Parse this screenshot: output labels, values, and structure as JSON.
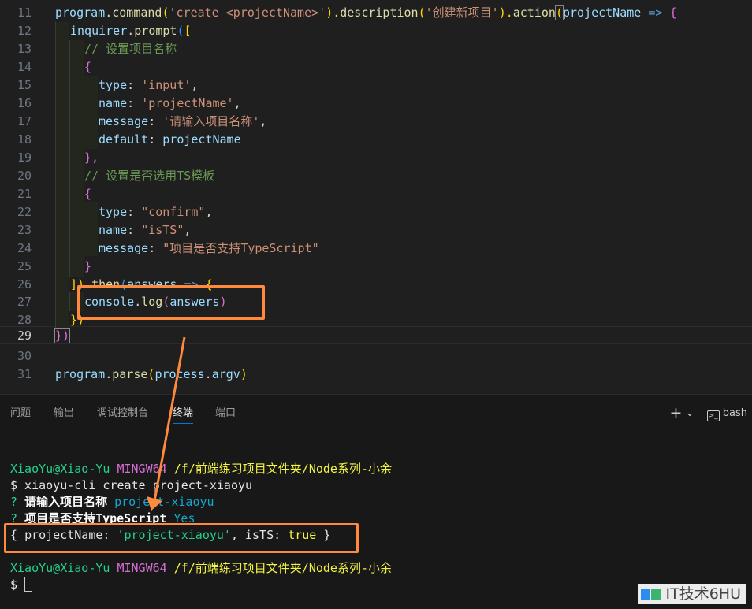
{
  "editor": {
    "lines": [
      {
        "n": "11",
        "html_key": "l11"
      },
      {
        "n": "12"
      },
      {
        "n": "13"
      },
      {
        "n": "14"
      },
      {
        "n": "15"
      },
      {
        "n": "16"
      },
      {
        "n": "17"
      },
      {
        "n": "18"
      },
      {
        "n": "19"
      },
      {
        "n": "20"
      },
      {
        "n": "21"
      },
      {
        "n": "22"
      },
      {
        "n": "23"
      },
      {
        "n": "24"
      },
      {
        "n": "25"
      },
      {
        "n": "26"
      },
      {
        "n": "27"
      },
      {
        "n": "28"
      },
      {
        "n": "29"
      },
      {
        "n": "30"
      },
      {
        "n": "31"
      }
    ],
    "code": {
      "l11": {
        "a": "program",
        "b": ".",
        "c": "command",
        "d": "(",
        "e": "'create <projectName>'",
        "f": ").",
        "g": "description",
        "h": "(",
        "i": "'创建新项目'",
        "j": ").",
        "k": "action",
        "l": "(",
        "m": "projectName",
        "n": " => ",
        "o": "{"
      },
      "l12": {
        "a": "inquirer",
        "b": ".",
        "c": "prompt",
        "d": "(",
        "e": "["
      },
      "l13": "// 设置项目名称",
      "l14": "{",
      "l15": {
        "k": "type",
        "v": "'input'"
      },
      "l16": {
        "k": "name",
        "v": "'projectName'"
      },
      "l17": {
        "k": "message",
        "v": "'请输入项目名称'"
      },
      "l18": {
        "k": "default",
        "v": "projectName"
      },
      "l19": "},",
      "l20": "// 设置是否选用TS模板",
      "l21": "{",
      "l22": {
        "k": "type",
        "v": "\"confirm\""
      },
      "l23": {
        "k": "name",
        "v": "\"isTS\""
      },
      "l24": {
        "k": "message",
        "v": "\"项目是否支持TypeScript\""
      },
      "l25": "}",
      "l26": {
        "a": "])",
        "b": ".",
        "c": "then",
        "d": "(",
        "e": "answers",
        "f": " => ",
        "g": "{"
      },
      "l27": {
        "a": "console",
        "b": ".",
        "c": "log",
        "d": "(",
        "e": "answers",
        "f": ")"
      },
      "l28": "})",
      "l29": "})",
      "l31": {
        "a": "program",
        "b": ".",
        "c": "parse",
        "d": "(",
        "e": "process",
        "f": ".",
        "g": "argv",
        "h": ")"
      }
    }
  },
  "panel": {
    "tabs": [
      "问题",
      "输出",
      "调试控制台",
      "终端",
      "端口"
    ],
    "active_tab": "终端",
    "shell": "bash",
    "add_glyph": "+",
    "chevron_glyph": "⌄"
  },
  "terminal": {
    "prompt_user": "XiaoYu@Xiao-Yu",
    "prompt_env": "MINGW64",
    "prompt_path": "/f/前端练习项目文件夹/Node系列-小余",
    "command": "$ xiaoyu-cli create project-xiaoyu",
    "q1_mark": "?",
    "q1_text": "请输入项目名称",
    "q1_answer": "project-xiaoyu",
    "q2_mark": "?",
    "q2_text": "项目是否支持TypeScript",
    "q2_answer": "Yes",
    "result": {
      "open": "{ ",
      "key1": "projectName",
      "colon1": ": ",
      "val1": "'project-xiaoyu'",
      "sep": ", ",
      "key2": "isTS",
      "colon2": ": ",
      "val2": "true",
      "close": " }"
    },
    "last_prompt": "$"
  },
  "watermark": {
    "text": "IT技术6HU"
  },
  "colors": {
    "highlight": "#ff8a3d",
    "accent": "#0078d4"
  }
}
